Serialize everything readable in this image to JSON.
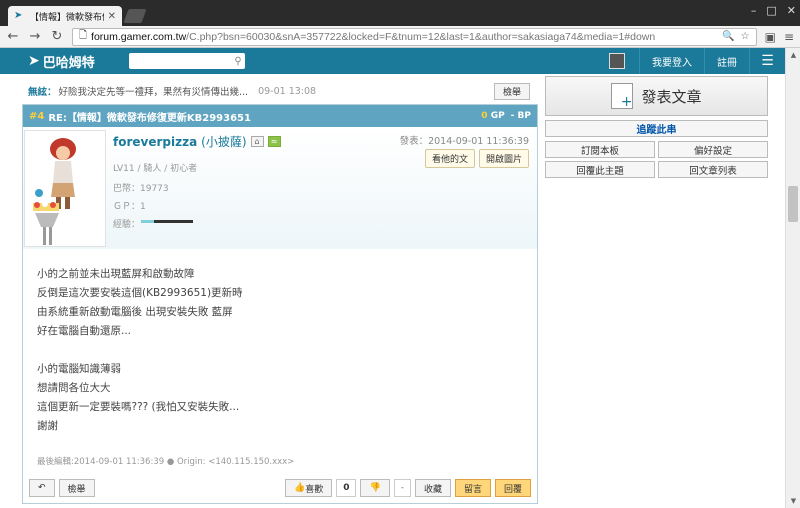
{
  "browser": {
    "tab_title": "【情報】微軟發布修復更新",
    "url_host": "forum.gamer.com.tw",
    "url_path": "/C.php?bsn=60030&snA=357722&locked=F&tnum=12&last=1&author=sakasiaga74&media=1#down"
  },
  "site": {
    "logo_text": "巴哈姆特",
    "login_label": "我要登入",
    "register_label": "註冊"
  },
  "news": {
    "label": "無絃：",
    "text": "好險我決定先等一禮拜，果然有災情傳出幾...",
    "time": "09-01 13:08",
    "report_label": "檢舉"
  },
  "post": {
    "floor": "#4",
    "title": "RE:【情報】微軟發布修復更新KB2993651",
    "gp_value": "0",
    "gp_label": "GP",
    "bp_label": "- BP",
    "author_id": "foreverpizza",
    "author_nick": "(小披薩)",
    "date": "發表：2014-09-01 11:36:39",
    "btn_view_posts": "看他的文",
    "btn_open_images": "開啟圖片",
    "level": "LV11 / 騎人 / 初心者",
    "coins": "巴幣：19773",
    "gp_stat": "ＧＰ：1",
    "exp_label": "經驗：",
    "exp_fraction": 0.25,
    "body": "小的之前並未出現藍屏和啟動故障\n反倒是這次要安裝這個(KB2993651)更新時\n由系統重新啟動電腦後 出現安裝失敗 藍屏\n好在電腦自動還原...\n\n小的電腦知識薄弱\n想請問各位大大\n這個更新一定要裝嗎??? (我怕又安裝失敗...\n謝謝",
    "edit_info": "最後編輯:2014-09-01 11:36:39 ● Origin: <140.115.150.xxx>"
  },
  "actions": {
    "report_label": "檢舉",
    "like_label": "喜歡",
    "like_count": "0",
    "bp_count": "-",
    "collect_label": "收藏",
    "comment_label": "留言",
    "reply_label": "回覆"
  },
  "sidebar": {
    "publish_label": "發表文章",
    "track_label": "追蹤此串",
    "subscribe_label": "訂閱本板",
    "preferences_label": "偏好設定",
    "reply_topic_label": "回覆此主題",
    "back_list_label": "回文章列表"
  },
  "colors": {
    "header_bg": "#1b7a9a",
    "post_title_bg": "#5fa4c0",
    "gp_color": "#ffcf3a"
  }
}
